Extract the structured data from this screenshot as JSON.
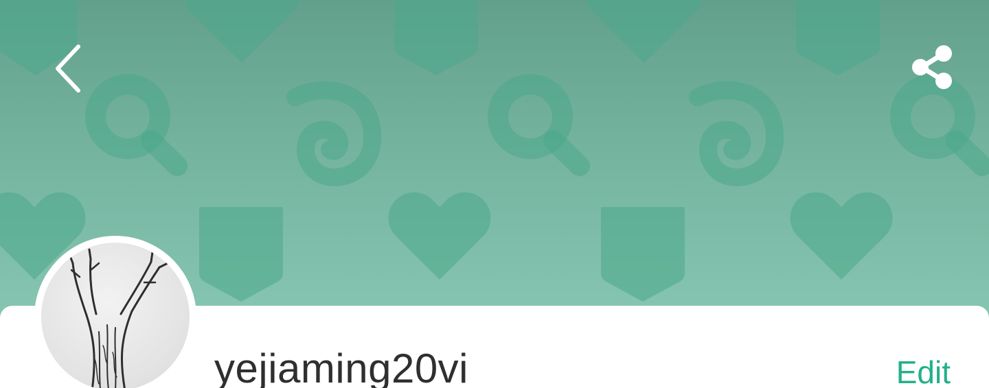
{
  "header": {
    "back_icon": "chevron-left-icon",
    "share_icon": "share-icon",
    "cover_pattern_icons": [
      "heart-icon",
      "bookmark-icon",
      "search-icon",
      "spiral-icon"
    ]
  },
  "profile": {
    "avatar_icon": "tree-drawing",
    "username": "yejiaming20vi",
    "edit_label": "Edit"
  },
  "colors": {
    "accent": "#22b08a",
    "cover_top": "#62a08c",
    "cover_bottom": "#86c6b2"
  }
}
